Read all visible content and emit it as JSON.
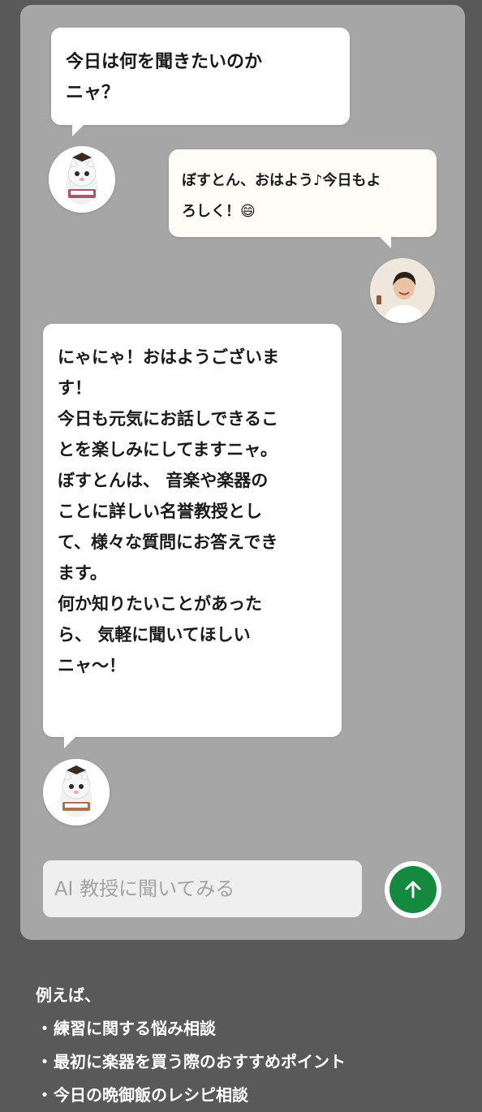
{
  "chat": {
    "messages": [
      {
        "sender": "bot",
        "text": "今日は何を聞きたいのか\nニャ？"
      },
      {
        "sender": "user",
        "text": "ぼすとん、おはよう♪今日もよ\nろしく！😄"
      },
      {
        "sender": "bot",
        "text": "にゃにゃ！おはようございま\nす！\n今日も元気にお話しできるこ\nとを楽しみにしてますニャ。\nぼすとんは、 音楽や楽器の\nことに詳しい名誉教授とし\nて、様々な質問にお答えでき\nます。\n何か知りたいことがあった\nら、 気軽に聞いてほしい\nニャ〜！"
      }
    ],
    "input": {
      "placeholder": "AI 教授に聞いてみる",
      "value": ""
    },
    "send_icon": "arrow-up-icon"
  },
  "avatars": {
    "bot_icon": "cat-professor-icon",
    "user_icon": "user-photo-icon"
  },
  "hints": {
    "title": "例えば、",
    "items": [
      "練習に関する悩み相談",
      "最初に楽器を買う際のおすすめポイント",
      "今日の晩御飯のレシピ相談"
    ]
  },
  "colors": {
    "background": "#595959",
    "panel": "#a6a6a6",
    "send_button": "#138a3e"
  }
}
